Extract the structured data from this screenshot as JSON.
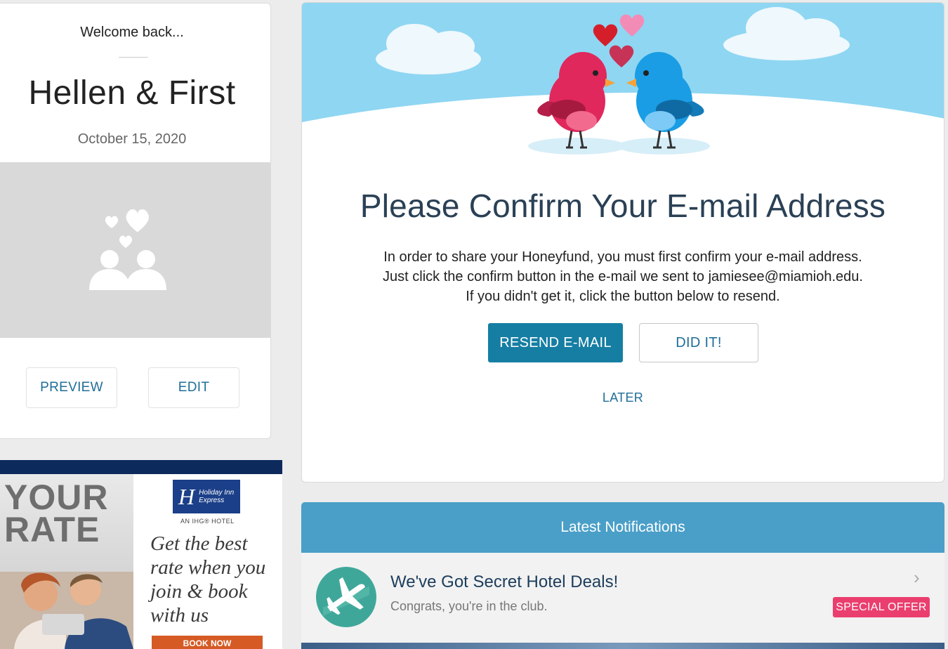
{
  "profile": {
    "welcome": "Welcome back...",
    "couple_name": "Hellen & First",
    "date": "October 15, 2020",
    "preview_label": "PREVIEW",
    "edit_label": "EDIT"
  },
  "ad": {
    "headline": "YOUR RATE",
    "logo_letter": "H",
    "logo_sub": "Holiday Inn Express",
    "ihg_line": "AN IHG® HOTEL",
    "tagline": "Get the best rate when you join & book with us",
    "cta": "BOOK NOW"
  },
  "confirm": {
    "title": "Please Confirm Your E-mail Address",
    "body_line1": "In order to share your Honeyfund, you must first confirm your e-mail address.",
    "body_line2": "Just click the confirm button in the e-mail we sent to jamiesee@miamioh.edu.",
    "body_line3": "If you didn't get it, click the button below to resend.",
    "resend_label": "RESEND E-MAIL",
    "didit_label": "DID IT!",
    "later_label": "LATER"
  },
  "notifications": {
    "header": "Latest Notifications",
    "items": [
      {
        "title": "We've Got Secret Hotel Deals!",
        "subtitle": "Congrats, you're in the club.",
        "badge": "SPECIAL OFFER",
        "icon": "airplane-icon"
      }
    ]
  },
  "colors": {
    "primary_button": "#167ea3",
    "link": "#1f6e99",
    "notif_header": "#4a9fc8",
    "badge": "#ea3f6e",
    "sky": "#8fd6f2"
  }
}
